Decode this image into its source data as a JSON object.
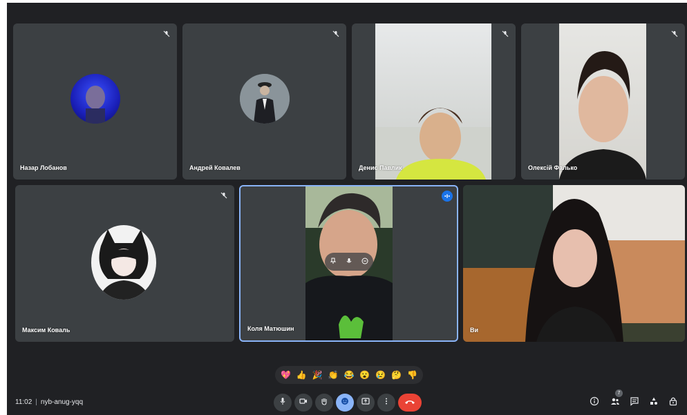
{
  "participants": [
    {
      "name": "Назар Лобанов",
      "muted": true
    },
    {
      "name": "Андрей Ковалев",
      "muted": true
    },
    {
      "name": "Денис Павлик",
      "muted": true
    },
    {
      "name": "Олексій Фалько",
      "muted": true
    },
    {
      "name": "Максим Коваль",
      "muted": true
    },
    {
      "name": "Коля Матюшин",
      "speaking": true
    },
    {
      "name": "Ви"
    }
  ],
  "reactions": [
    "💖",
    "👍",
    "🎉",
    "👏",
    "😂",
    "😮",
    "😢",
    "🤔",
    "👎"
  ],
  "meeting": {
    "time": "11:02",
    "separator": "|",
    "code": "nyb-anug-yqq"
  },
  "controls": [
    "mic-icon",
    "camera-icon",
    "raise-hand-icon",
    "reactions-icon",
    "present-icon",
    "more-options-icon",
    "end-call-icon"
  ],
  "right_controls": [
    "info-icon",
    "people-icon",
    "chat-icon",
    "activities-icon",
    "host-controls-icon"
  ],
  "people_count": "7",
  "colors": {
    "background": "#202124",
    "tile": "#3c4043",
    "accent": "#8ab4f8",
    "end_call": "#ea4335"
  }
}
